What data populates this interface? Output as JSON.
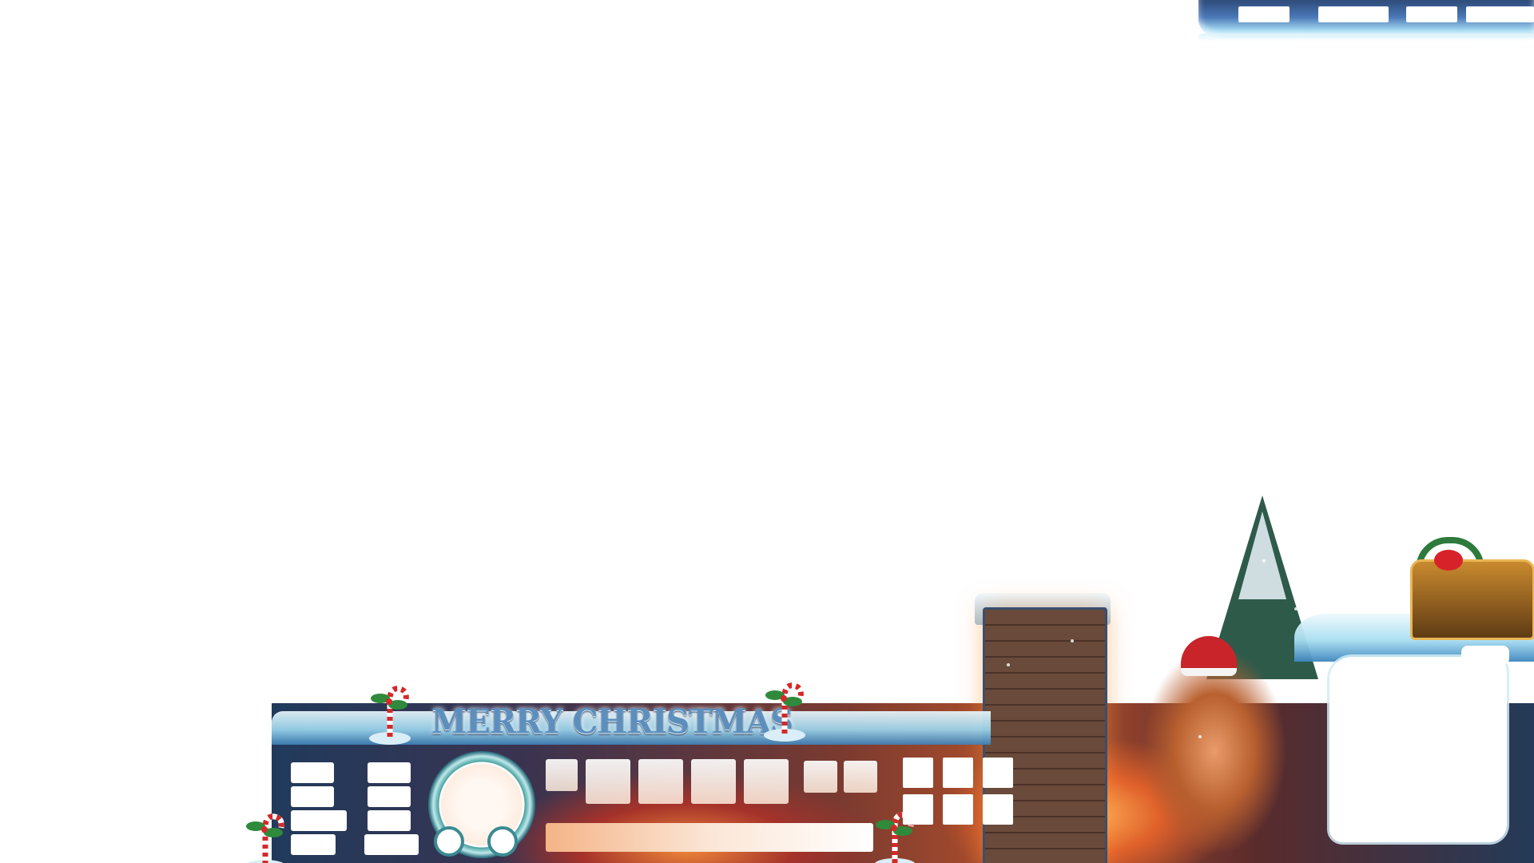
{
  "hud": {
    "title_text": "MERRY CHRISTMAS",
    "theme": "christmas",
    "accent_colors": {
      "ice_light": "#eaf8fd",
      "ice_dark": "#3e7fb4",
      "frame_teal": "#3b8a93",
      "fire_orange": "#e0612a",
      "resource_bar": "#f4b487"
    },
    "icons": {
      "candy_cane": "candy-cane-icon",
      "treasure_chest": "treasure-chest-icon",
      "christmas_tree": "christmas-tree-icon",
      "wreath": "wreath-icon"
    }
  }
}
